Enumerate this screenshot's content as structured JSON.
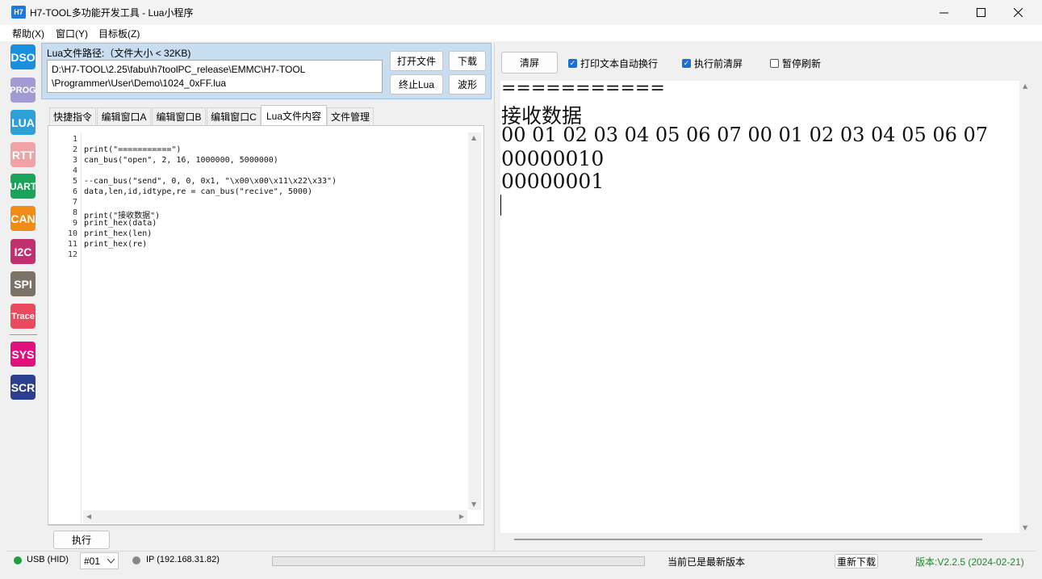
{
  "window": {
    "icon_text": "H7",
    "title": "H7-TOOL多功能开发工具 - Lua小程序"
  },
  "menu": [
    "帮助(X)",
    "窗口(Y)",
    "目标板(Z)"
  ],
  "tools": [
    {
      "label": "DSO",
      "color": "#1a8fe0"
    },
    {
      "label": "PROG",
      "color": "#a29ad2"
    },
    {
      "label": "LUA",
      "color": "#2f9fd8"
    },
    {
      "label": "RTT",
      "color": "#f0a2a6"
    },
    {
      "label": "UART",
      "color": "#1aa45a"
    },
    {
      "label": "CAN",
      "color": "#ef8c16"
    },
    {
      "label": "I2C",
      "color": "#c0306e"
    },
    {
      "label": "SPI",
      "color": "#7d7268"
    },
    {
      "label": "Trace",
      "color": "#e94a5d"
    },
    {
      "label": "SYS",
      "color": "#e0107c"
    },
    {
      "label": "SCR",
      "color": "#2c3f8e"
    }
  ],
  "lua_panel": {
    "path_label": "Lua文件路径:（文件大小 < 32KB)",
    "path_line1": "D:\\H7-TOOL\\2.25\\fabu\\h7toolPC_release\\EMMC\\H7-TOOL",
    "path_line2": "\\Programmer\\User\\Demo\\1024_0xFF.lua",
    "btn_open": "打开文件",
    "btn_download": "下载",
    "btn_stop": "终止Lua",
    "btn_wave": "波形"
  },
  "tabs": [
    "快捷指令",
    "编辑窗口A",
    "编辑窗口B",
    "编辑窗口C",
    "Lua文件内容",
    "文件管理"
  ],
  "active_tab": "Lua文件内容",
  "code_lines": [
    "",
    "print(\"===========\")",
    "can_bus(\"open\", 2, 16, 1000000, 5000000)",
    "",
    "--can_bus(\"send\", 0, 0, 0x1, \"\\x00\\x00\\x11\\x22\\x33\")",
    "data,len,id,idtype,re = can_bus(\"recive\", 5000)",
    "",
    "print(\"接收数据\")",
    "print_hex(data)",
    "print_hex(len)",
    "print_hex(re)",
    ""
  ],
  "line_numbers": [
    "1",
    "2",
    "3",
    "4",
    "5",
    "6",
    "7",
    "8",
    "9",
    "10",
    "11",
    "12"
  ],
  "run_button": "执行",
  "right_toolbar": {
    "clear_button": "清屏",
    "opt_wrap": {
      "label": "打印文本自动换行",
      "checked": true
    },
    "opt_clear_before": {
      "label": "执行前清屏",
      "checked": true
    },
    "opt_pause": {
      "label": "暂停刷新",
      "checked": false
    }
  },
  "output_lines": [
    "===========",
    "接收数据",
    "00 01 02 03 04 05 06 07 00 01 02 03 04 05 06 07",
    "00000010",
    "00000001"
  ],
  "status": {
    "usb": "USB (HID)",
    "device": "#01",
    "ip": "IP (192.168.31.82)",
    "update_msg": "当前已是最新版本",
    "redownload": "重新下载",
    "version": "版本:V2.2.5 (2024-02-21)",
    "usb_color": "#1aa03c",
    "ip_dot_color": "#888888",
    "version_color": "#1a8a2a"
  }
}
